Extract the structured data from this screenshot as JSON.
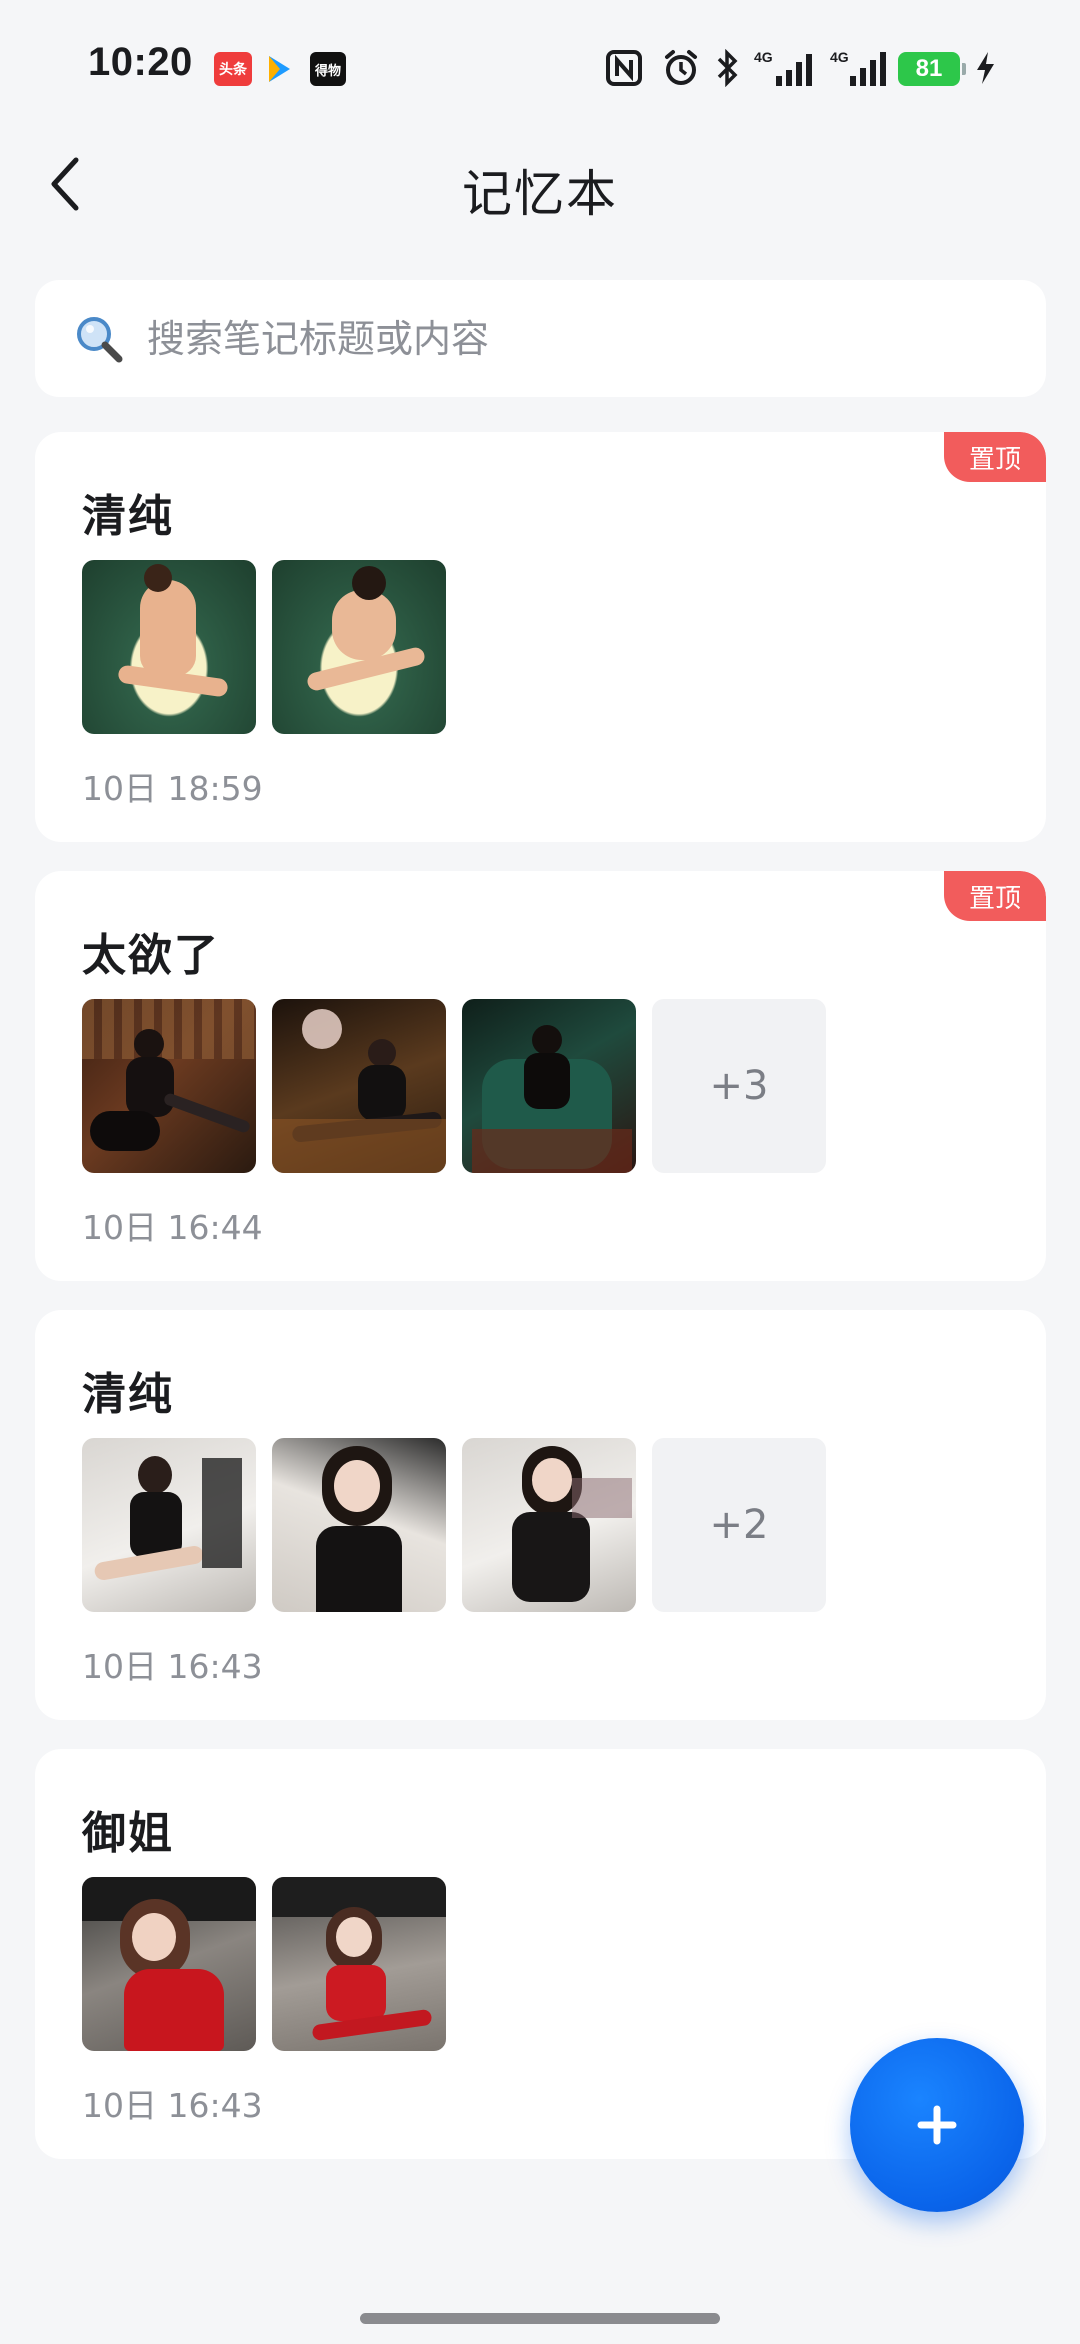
{
  "status_bar": {
    "time": "10:20",
    "apps": [
      "头条",
      "得物"
    ],
    "network": [
      "4G",
      "4G"
    ],
    "battery": "81"
  },
  "header": {
    "title": "记忆本"
  },
  "search": {
    "placeholder": "搜索笔记标题或内容"
  },
  "notes": [
    {
      "title": "清纯",
      "pinned_label": "置顶",
      "time": "10日 18:59",
      "more_count": ""
    },
    {
      "title": "太欲了",
      "pinned_label": "置顶",
      "time": "10日 16:44",
      "more_count": "+3"
    },
    {
      "title": "清纯",
      "pinned_label": "",
      "time": "10日 16:43",
      "more_count": "+2"
    },
    {
      "title": "御姐",
      "pinned_label": "",
      "time": "10日 16:43",
      "more_count": ""
    }
  ],
  "colors": {
    "accent": "#0a64ea",
    "pin_badge": "#f25c5c",
    "background": "#f5f6f8",
    "muted_text": "#8d9097"
  },
  "icons": {
    "back": "chevron-left-icon",
    "search": "magnifier-icon",
    "add": "plus-icon"
  }
}
